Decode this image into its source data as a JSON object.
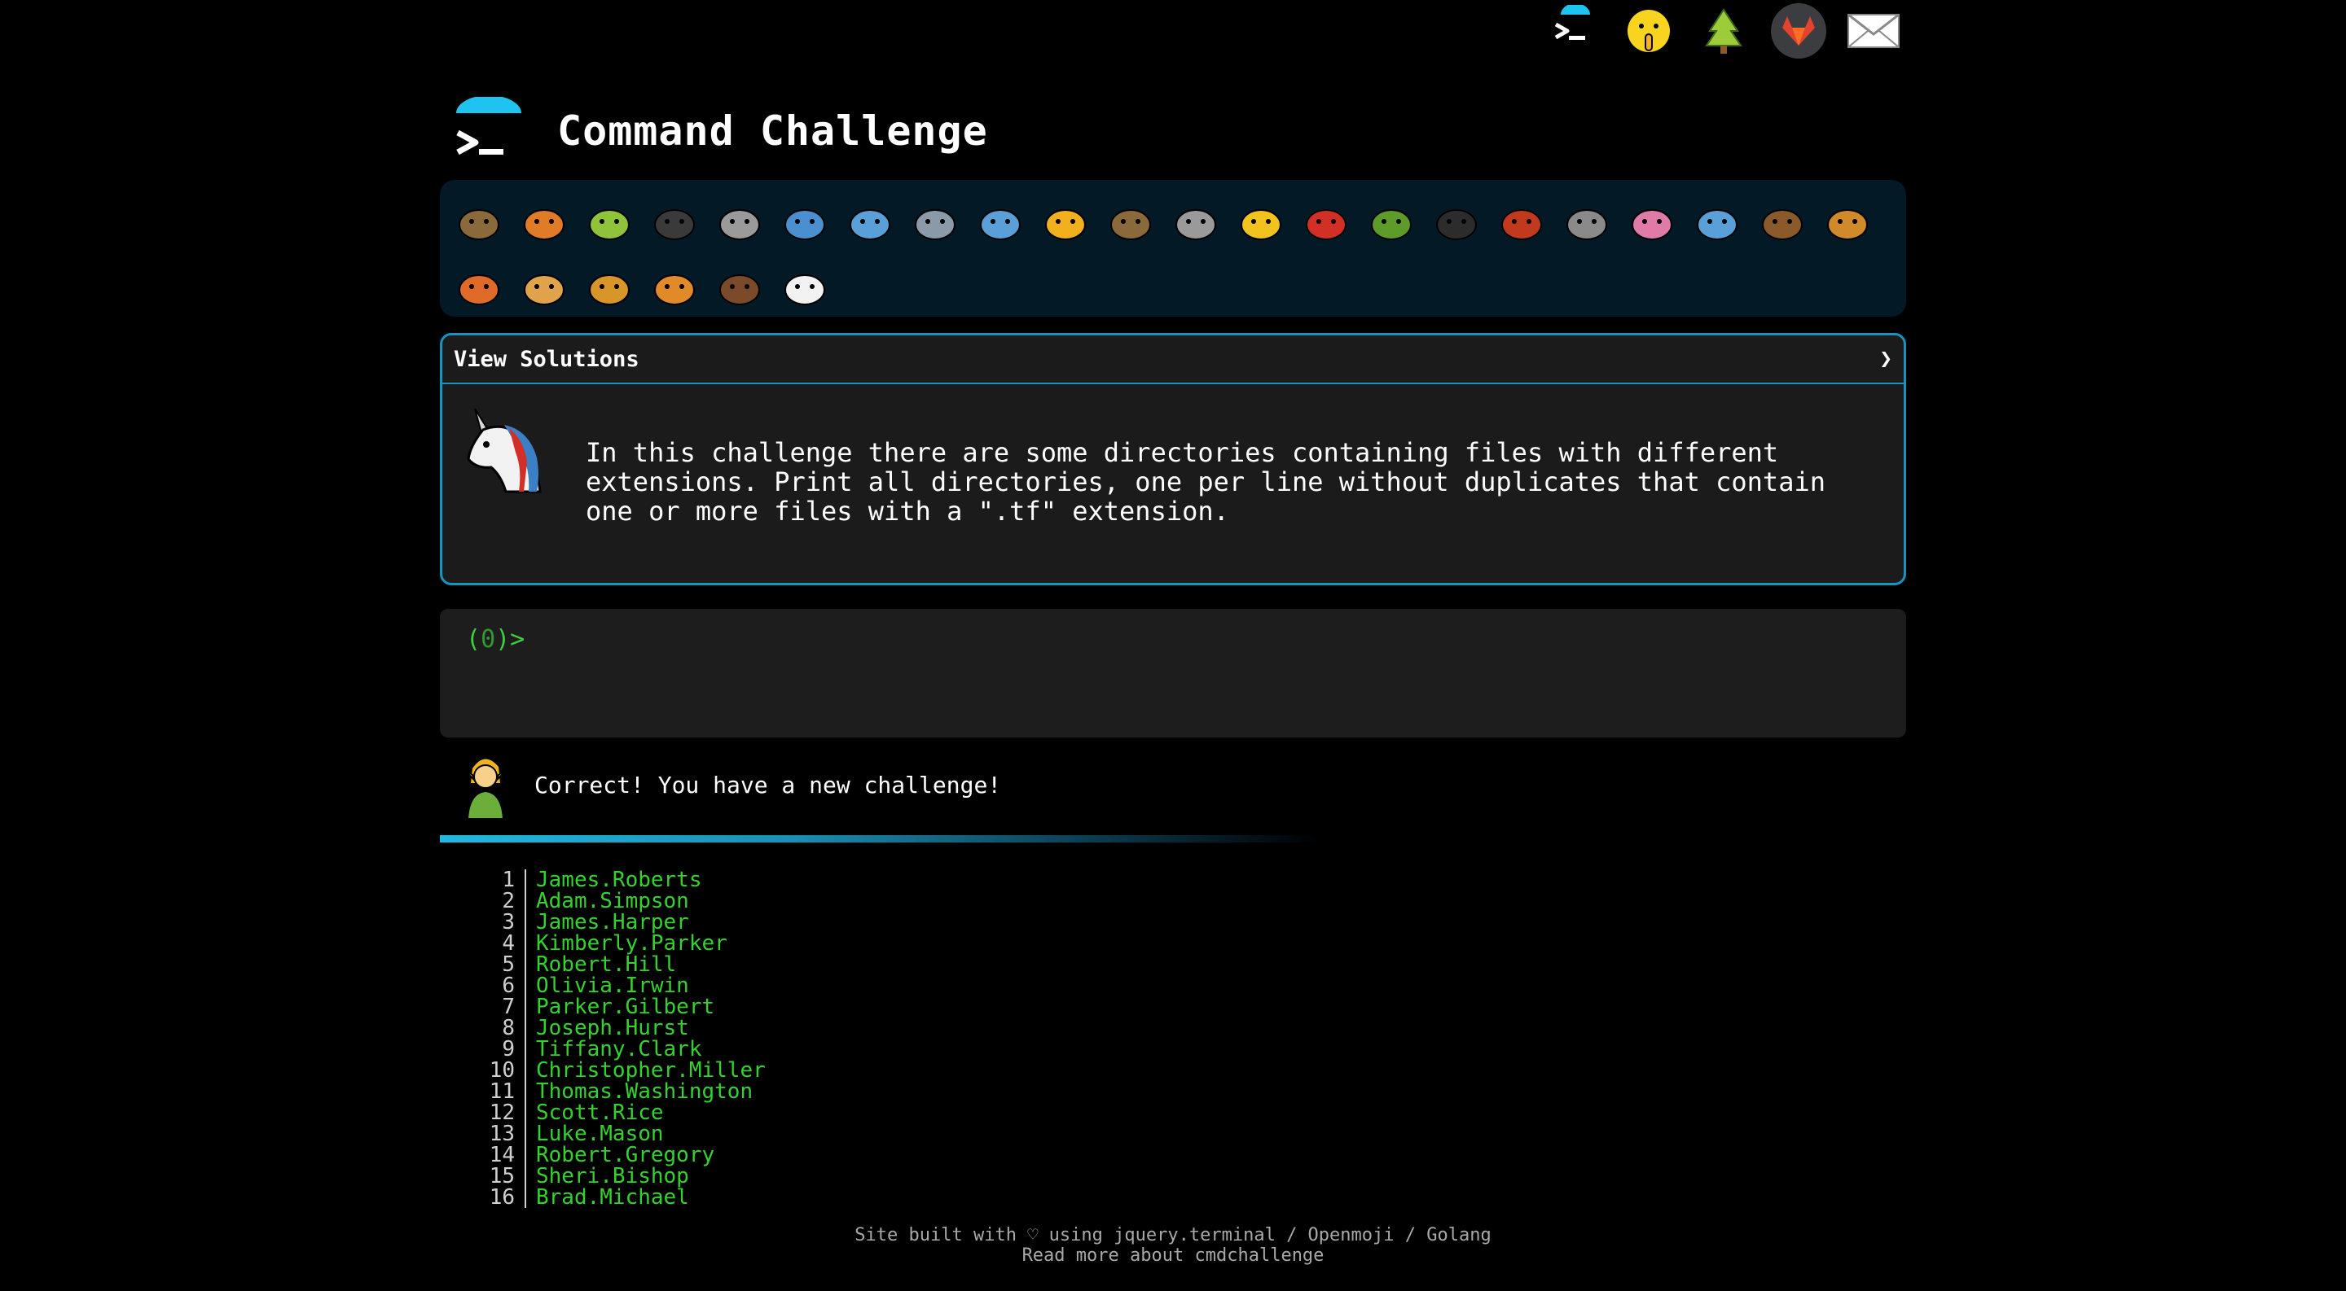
{
  "nav": {
    "icons": [
      "terminal-icon",
      "shushing-face-icon",
      "tree-icon",
      "gitlab-icon",
      "envelope-icon"
    ]
  },
  "header": {
    "title": "Command Challenge"
  },
  "animals": [
    "snail",
    "butterfly",
    "caterpillar",
    "ant",
    "spider-web",
    "whale",
    "dolphin",
    "shark",
    "fish",
    "tropical-fish",
    "pufferfish",
    "wolf",
    "bee",
    "ladybug",
    "cricket",
    "spider",
    "scorpion",
    "fly",
    "worm",
    "microbe",
    "monkey",
    "dog",
    "fox",
    "cat",
    "lion",
    "tiger",
    "horse",
    "unicorn"
  ],
  "challenge": {
    "header_label": "View Solutions",
    "chevron": "❯",
    "text": "In this challenge there are some directories containing files with different extensions. Print all directories, one per line without duplicates that contain one or more files with a \".tf\" extension."
  },
  "terminal": {
    "prompt_open": "(",
    "prompt_count": "0",
    "prompt_close": ")>"
  },
  "message": {
    "text": "Correct! You have a new challenge!"
  },
  "output": [
    {
      "n": "1",
      "name": "James.Roberts"
    },
    {
      "n": "2",
      "name": "Adam.Simpson"
    },
    {
      "n": "3",
      "name": "James.Harper"
    },
    {
      "n": "4",
      "name": "Kimberly.Parker"
    },
    {
      "n": "5",
      "name": "Robert.Hill"
    },
    {
      "n": "6",
      "name": "Olivia.Irwin"
    },
    {
      "n": "7",
      "name": "Parker.Gilbert"
    },
    {
      "n": "8",
      "name": "Joseph.Hurst"
    },
    {
      "n": "9",
      "name": "Tiffany.Clark"
    },
    {
      "n": "10",
      "name": "Christopher.Miller"
    },
    {
      "n": "11",
      "name": "Thomas.Washington"
    },
    {
      "n": "12",
      "name": "Scott.Rice"
    },
    {
      "n": "13",
      "name": "Luke.Mason"
    },
    {
      "n": "14",
      "name": "Robert.Gregory"
    },
    {
      "n": "15",
      "name": "Sheri.Bishop"
    },
    {
      "n": "16",
      "name": "Brad.Michael"
    }
  ],
  "footer": {
    "line1": "Site built with ♡ using jquery.terminal / Openmoji / Golang",
    "line2": "Read more about cmdchallenge"
  }
}
